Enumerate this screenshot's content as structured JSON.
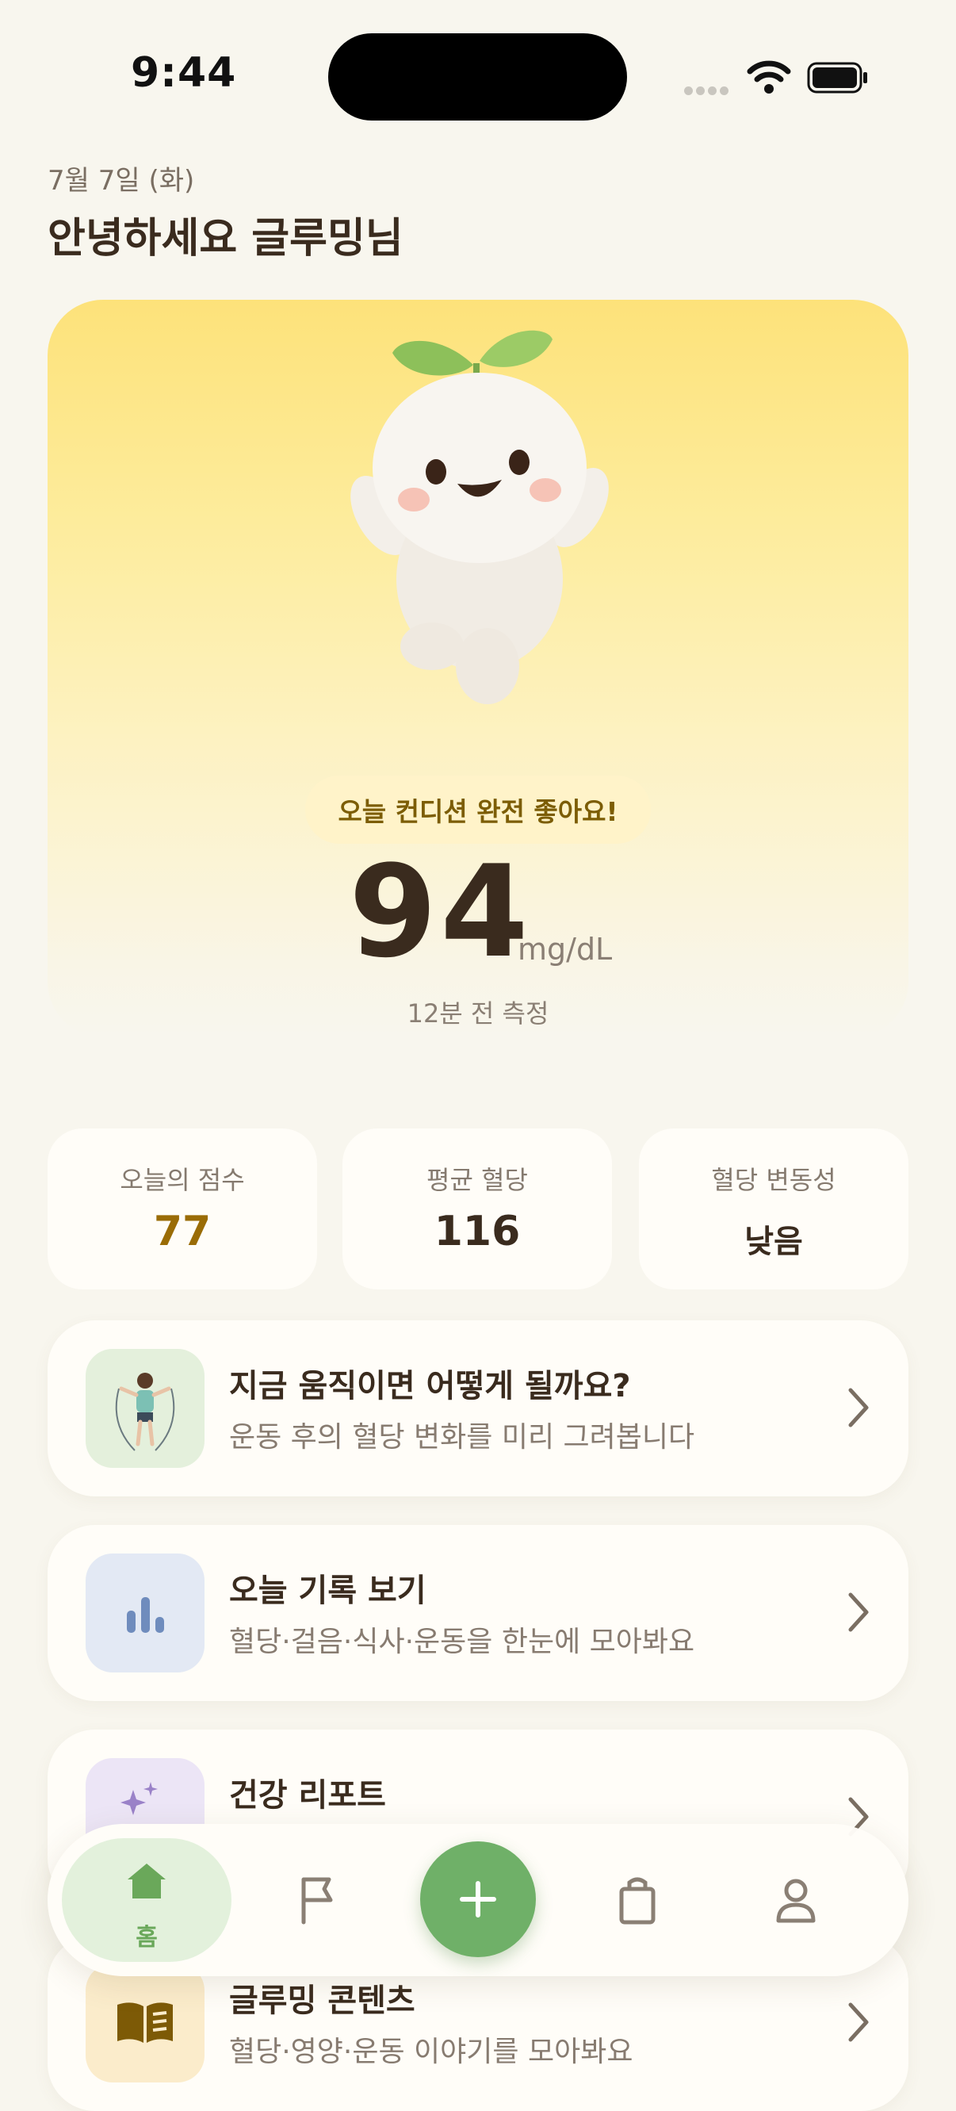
{
  "status": {
    "time": "9:44"
  },
  "header": {
    "date": "7월 7일 (화)",
    "greeting": "안녕하세요 글루밍님"
  },
  "hero": {
    "condition": "오늘 컨디션 완전 좋아요!",
    "glucose_value": "94",
    "glucose_unit": "mg/dL",
    "measured": "12분 전 측정"
  },
  "stats": [
    {
      "label": "오늘의 점수",
      "value": "77"
    },
    {
      "label": "평균 혈당",
      "value": "116"
    },
    {
      "label": "혈당 변동성",
      "value": "낮음"
    }
  ],
  "menus": [
    {
      "title": "지금 움직이면 어떻게 될까요?",
      "subtitle": "운동 후의 혈당 변화를 미리 그려봅니다",
      "icon": "jump-rope-icon"
    },
    {
      "title": "오늘 기록 보기",
      "subtitle": "혈당·걸음·식사·운동을 한눈에 모아봐요",
      "icon": "bar-chart-icon"
    },
    {
      "title": "건강 리포트",
      "subtitle": "",
      "icon": "sparkle-icon"
    },
    {
      "title": "글루밍 콘텐츠",
      "subtitle": "혈당·영양·운동 이야기를 모아봐요",
      "icon": "book-icon"
    }
  ],
  "nav": {
    "home_label": "홈",
    "items": [
      "home-icon",
      "flag-icon",
      "add-icon",
      "shopping-bag-icon",
      "profile-icon"
    ]
  },
  "colors": {
    "background": "#f8f6ee",
    "accent_green": "#6fb068",
    "score_gold": "#9a6c06",
    "hero_yellow": "#fde27a"
  }
}
